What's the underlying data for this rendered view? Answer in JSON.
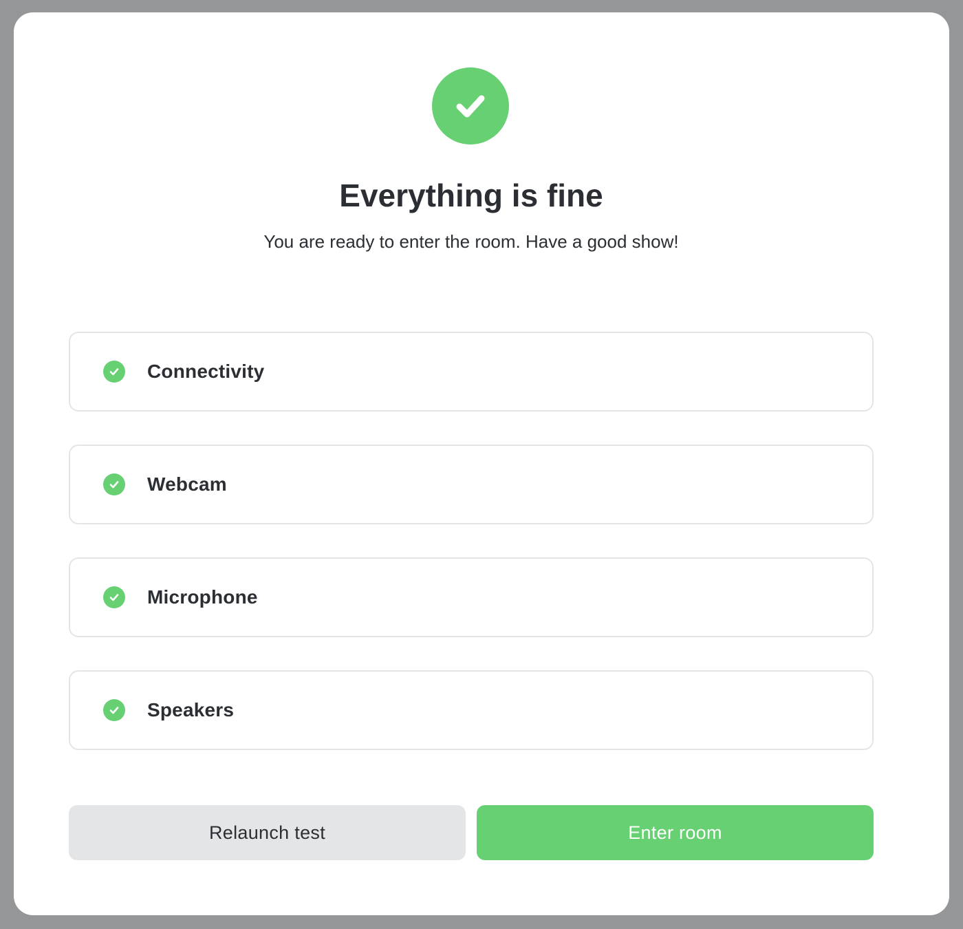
{
  "header": {
    "status_icon": "check-circle-icon",
    "title": "Everything is fine",
    "subtitle": "You are ready to enter the room. Have a good show!"
  },
  "checks": [
    {
      "label": "Connectivity",
      "status": "passed",
      "icon": "check-circle-icon"
    },
    {
      "label": "Webcam",
      "status": "passed",
      "icon": "check-circle-icon"
    },
    {
      "label": "Microphone",
      "status": "passed",
      "icon": "check-circle-icon"
    },
    {
      "label": "Speakers",
      "status": "passed",
      "icon": "check-circle-icon"
    }
  ],
  "actions": {
    "relaunch_label": "Relaunch test",
    "enter_label": "Enter room"
  },
  "colors": {
    "success": "#67d073",
    "text": "#2b2f34",
    "secondary_button": "#e4e5e7",
    "border": "#e3e5e8",
    "backdrop": "#959697"
  }
}
